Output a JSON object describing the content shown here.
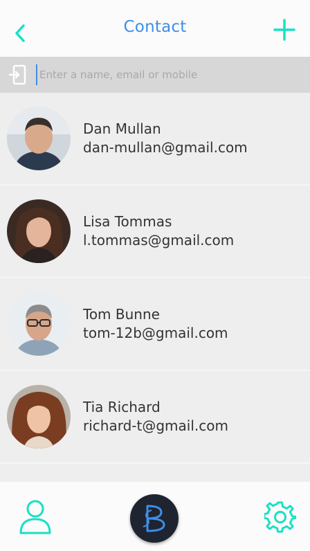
{
  "header": {
    "title": "Contact",
    "back_icon": "chevron-left-icon",
    "add_icon": "plus-icon",
    "accent_color": "#19e0c4",
    "title_color": "#3e8ee8"
  },
  "search": {
    "placeholder": "Enter a name, email or mobile",
    "value": "",
    "icon": "login-icon"
  },
  "contacts": [
    {
      "name": "Dan Mullan",
      "email": "dan-mullan@gmail.com"
    },
    {
      "name": "Lisa Tommas",
      "email": "l.tommas@gmail.com"
    },
    {
      "name": "Tom Bunne",
      "email": "tom-12b@gmail.com"
    },
    {
      "name": "Tia Richard",
      "email": "richard-t@gmail.com"
    }
  ],
  "footer": {
    "left_icon": "user-icon",
    "center_icon": "brand-logo-icon",
    "right_icon": "gear-icon"
  }
}
